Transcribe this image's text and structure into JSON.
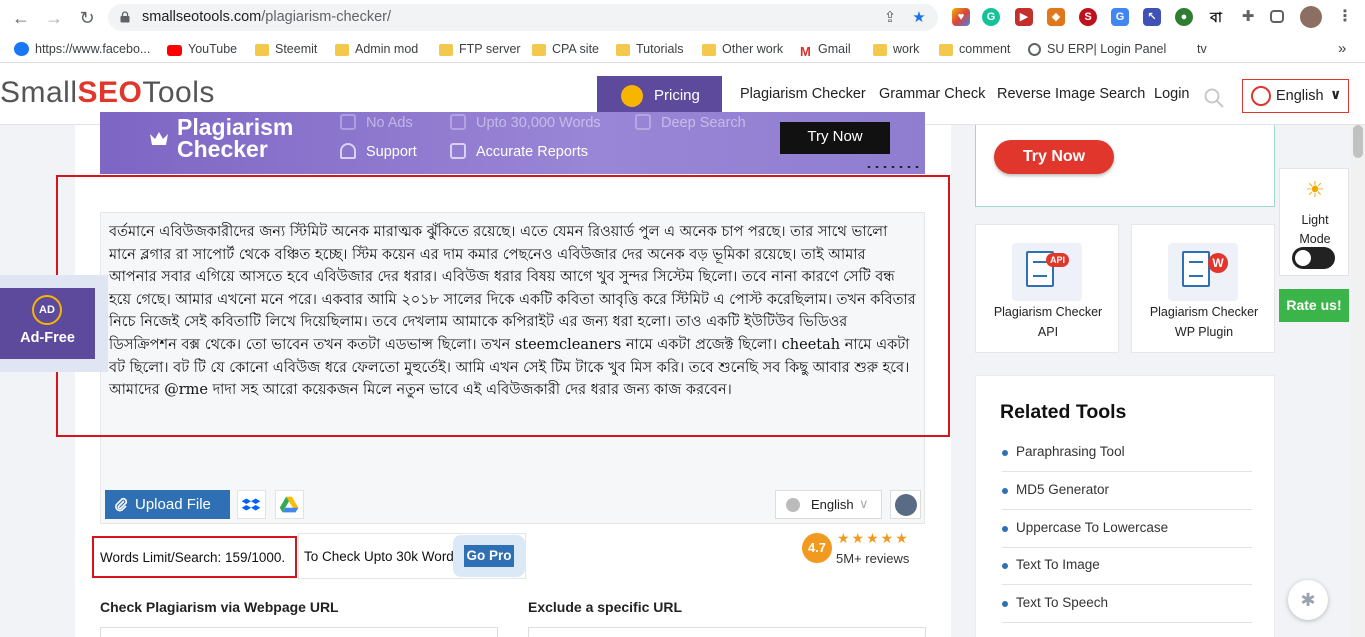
{
  "browser": {
    "url_host": "smallseotools.com",
    "url_path": "/plagiarism-checker/",
    "bookmarks": [
      {
        "label": "https://www.facebo...",
        "icon": "facebook-icon"
      },
      {
        "label": "YouTube",
        "icon": "youtube-icon"
      },
      {
        "label": "Steemit",
        "icon": "folder-icon"
      },
      {
        "label": "Admin mod",
        "icon": "folder-icon"
      },
      {
        "label": "FTP server",
        "icon": "folder-icon"
      },
      {
        "label": "CPA site",
        "icon": "folder-icon"
      },
      {
        "label": "Tutorials",
        "icon": "folder-icon"
      },
      {
        "label": "Other work",
        "icon": "folder-icon"
      },
      {
        "label": "Gmail",
        "icon": "gmail-icon"
      },
      {
        "label": "work",
        "icon": "folder-icon"
      },
      {
        "label": "comment",
        "icon": "folder-icon"
      },
      {
        "label": "SU ERP| Login Panel",
        "icon": "globe-icon"
      },
      {
        "label": "tv",
        "icon": "none"
      }
    ],
    "bangla_ext": "বা",
    "more": "»"
  },
  "header": {
    "logo": {
      "small": "Small",
      "seo": "SEO",
      "tools": "Tools"
    },
    "pricing": "Pricing",
    "nav": [
      "Plagiarism Checker",
      "Grammar Check",
      "Reverse Image Search",
      "Login"
    ],
    "language": "English"
  },
  "banner": {
    "title_line1": "Plagiarism",
    "title_line2": "Checker",
    "features_top": [
      "No Ads",
      "Upto 30,000 Words",
      "Deep Search"
    ],
    "features": [
      "Support",
      "Accurate Reports"
    ],
    "try_now": "Try Now"
  },
  "editor": {
    "text": "বর্তমানে এবিউজকারীদের জন্য স্টিমিট অনেক মারাত্মক ঝুঁকিতে রয়েছে। এতে যেমন রিওয়ার্ড পুল এ অনেক চাপ পরছে। তার সাথে ভালো মানে ব্লগার রা সাপোর্ট থেকে বঞ্চিত হচ্ছে। স্টিম কয়েন এর দাম কমার পেছনেও এবিউজার দের অনেক বড় ভূমিকা রয়েছে। তাই আমার আপনার সবার এগিয়ে আসতে হবে এবিউজার দের ধরার। এবিউজ ধরার বিষয় আগে খুব সুন্দর সিস্টেম ছিলো। তবে নানা কারণে সেটি বন্ধ হয়ে গেছে। আমার এখনো মনে পরে। একবার আমি ২০১৮ সালের দিকে একটি কবিতা আবৃত্তি করে স্টিমিট এ পোস্ট করেছিলাম। তখন কবিতার নিচে নিজেই সেই কবিতাটি লিখে দিয়েছিলাম। তবে দেখলাম আমাকে কপিরাইট এর জন্য ধরা হলো। তাও একটি ইউটিউব ভিডিওর ডিসক্রিপশন বক্স থেকে। তো ভাবেন তখন কতটা এডভান্স ছিলো। তখন steemcleaners নামে একটা প্রজেক্ট ছিলো। cheetah নামে একটা বট ছিলো। বট টি যে কোনো এবিউজ ধরে ফেলতো মুহুর্তেই। আমি এখন সেই টিম টাকে খুব মিস করি। তবে শুনেছি সব কিছু আবার শুরু হবে। আমাদের @rme দাদা সহ আরো কয়েকজন মিলে নতুন ভাবে এই এবিউজকারী দের ধরার জন্য কাজ করবেন।",
    "upload": "Upload File",
    "lang": "English"
  },
  "limits": {
    "words": "Words Limit/Search: 159/1000.",
    "upto": "To Check Upto 30k Words",
    "gopro": "Go Pro"
  },
  "rating": {
    "score": "4.7",
    "stars": "★★★★★",
    "reviews": "5M+ reviews"
  },
  "sections": {
    "webpage": "Check Plagiarism via Webpage URL",
    "exclude": "Exclude a specific URL"
  },
  "adfree": {
    "badge": "AD",
    "label": "Ad-Free"
  },
  "sidebar": {
    "try_now": "Try Now",
    "plugins": [
      {
        "line1": "Plagiarism Checker",
        "line2": "API",
        "badge": "API"
      },
      {
        "line1": "Plagiarism Checker",
        "line2": "WP Plugin",
        "badge": "W"
      }
    ],
    "light_mode": [
      "Light",
      "Mode"
    ],
    "rate_us": "Rate us!",
    "related_title": "Related Tools",
    "related": [
      "Paraphrasing Tool",
      "MD5 Generator",
      "Uppercase To Lowercase",
      "Text To Image",
      "Text To Speech"
    ]
  },
  "colors": {
    "brand_red": "#e0362b",
    "brand_purple": "#5d4a9c",
    "accent_blue": "#2f6fb4",
    "rate_green": "#3bb54a"
  }
}
